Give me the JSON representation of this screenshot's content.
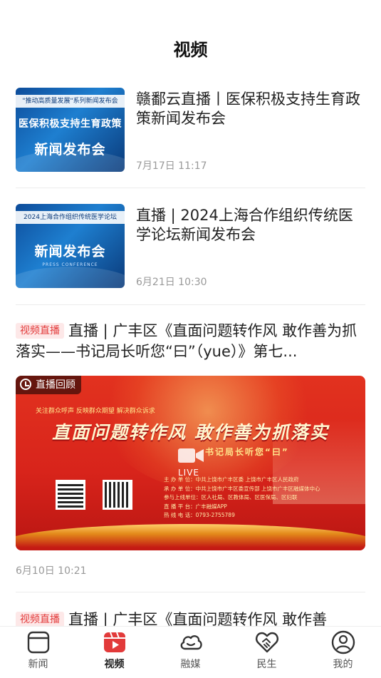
{
  "header": {
    "title": "视频"
  },
  "colors": {
    "accent": "#e23a3a",
    "tag_bg": "#fde8e8",
    "muted": "#999999"
  },
  "feed": {
    "items": [
      {
        "title": "赣鄱云直播丨医保积极支持生育政策新闻发布会",
        "time": "7月17日 11:17",
        "thumb": {
          "band": "\"推动高质量发展\"系列新闻发布会",
          "sub": "医保积极支持生育政策",
          "big": "新闻发布会",
          "press": ""
        }
      },
      {
        "title": "直播 | 2024上海合作组织传统医学论坛新闻发布会",
        "time": "6月21日 10:30",
        "thumb": {
          "band": "",
          "sub": "2024上海合作组织传统医学论坛",
          "big": "新闻发布会",
          "press": "PRESS CONFERENCE"
        }
      }
    ],
    "live_items": [
      {
        "tag": "视频直播",
        "title": "直播 | 广丰区《直面问题转作风 敢作善为抓落实——书记局长听您“曰”（yue）》第七...",
        "time": "6月10日 10:21",
        "banner": {
          "badge": "直播回顾",
          "slogan": "关注群众呼声  反映群众期望  解决群众诉求",
          "headline": "直面问题转作风   敢作善为抓落实",
          "subhead": "书记局长听您“曰”",
          "live_text": "LIVE",
          "info": [
            "主 办 单 位：中共上饶市广丰区委  上饶市广丰区人民政府",
            "承 办 单 位：中共上饶市广丰区委宣传部  上饶市广丰区融媒体中心",
            "参与上线单位：区人社局、区教体局、区医保局、区妇联",
            "直 播 平 台：广丰融媒APP",
            "热 线 电 话：0793-2755789"
          ]
        }
      },
      {
        "tag": "视频直播",
        "title": "直播 | 广丰区《直面问题转作风 敢作善"
      }
    ]
  },
  "tabbar": {
    "tabs": [
      {
        "label": "新闻",
        "icon": "news-icon"
      },
      {
        "label": "视频",
        "icon": "video-icon"
      },
      {
        "label": "融媒",
        "icon": "cloud-icon"
      },
      {
        "label": "民生",
        "icon": "heart-handshake-icon"
      },
      {
        "label": "我的",
        "icon": "user-icon"
      }
    ],
    "active_index": 1
  }
}
